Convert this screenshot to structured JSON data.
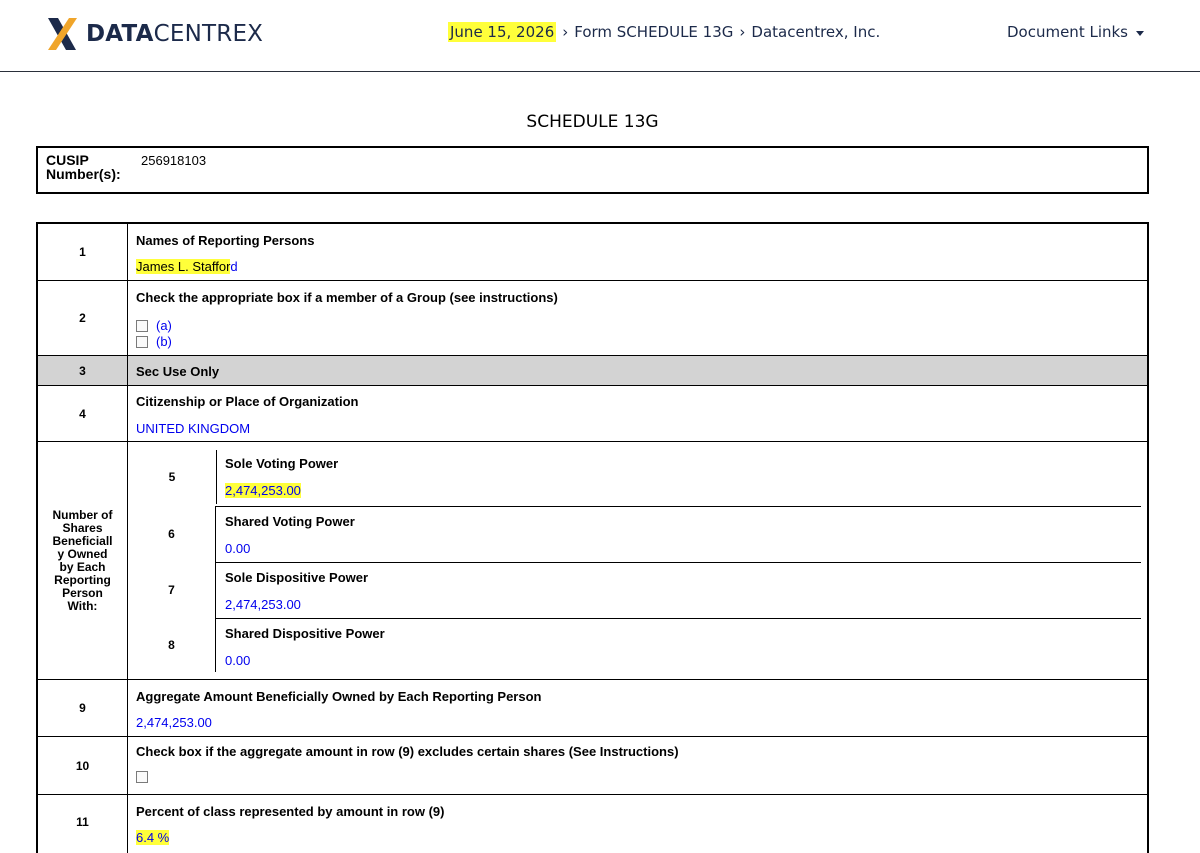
{
  "header": {
    "logo": {
      "bold": "DATA",
      "light": "CENTREX"
    },
    "breadcrumb": {
      "date": "June 15, 2026",
      "sep": "›",
      "form": "Form SCHEDULE 13G",
      "company": "Datacentrex, Inc."
    },
    "document_links": "Document Links"
  },
  "form_title": "SCHEDULE 13G",
  "cusip": {
    "label_line1": "CUSIP",
    "label_line2": "Number(s):",
    "value": "256918103"
  },
  "rows": {
    "r1": {
      "num": "1",
      "caption": "Names of Reporting Persons",
      "value_highlight": "James L. Staffor",
      "value_rest": "d"
    },
    "r2": {
      "num": "2",
      "caption": "Check the appropriate box if a member of a Group (see instructions)",
      "opt_a": "(a)",
      "opt_b": "(b)"
    },
    "r3": {
      "num": "3",
      "caption": "Sec Use Only"
    },
    "r4": {
      "num": "4",
      "caption": "Citizenship or Place of Organization",
      "value": "UNITED KINGDOM"
    },
    "shares_label": [
      "Number of",
      "Shares",
      "Beneficiall",
      "y Owned",
      "by Each",
      "Reporting",
      "Person",
      "With:"
    ],
    "r5": {
      "num": "5",
      "caption": "Sole Voting Power",
      "value": "2,474,253.00"
    },
    "r6": {
      "num": "6",
      "caption": "Shared Voting Power",
      "value": "0.00"
    },
    "r7": {
      "num": "7",
      "caption": "Sole Dispositive Power",
      "value": "2,474,253.00"
    },
    "r8": {
      "num": "8",
      "caption": "Shared Dispositive Power",
      "value": "0.00"
    },
    "r9": {
      "num": "9",
      "caption": "Aggregate Amount Beneficially Owned by Each Reporting Person",
      "value": "2,474,253.00"
    },
    "r10": {
      "num": "10",
      "caption": "Check box if the aggregate amount in row (9) excludes certain shares (See Instructions)"
    },
    "r11": {
      "num": "11",
      "caption": "Percent of class represented by amount in row (9)",
      "value": "6.4 %"
    }
  },
  "colors": {
    "highlight": "#ffff3a",
    "link": "#0000ee",
    "brand_navy": "#1c2a4a",
    "section_gray": "#d3d3d3"
  }
}
